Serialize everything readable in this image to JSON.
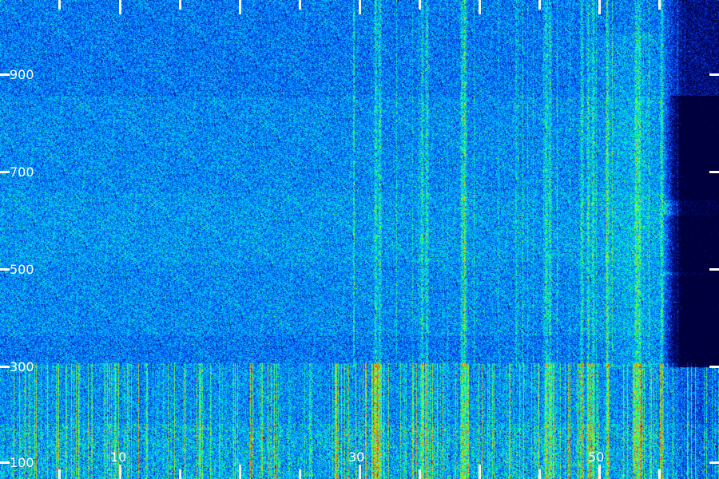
{
  "spectrogram": {
    "colormap": [
      "#00003c",
      "#0014a0",
      "#0050ff",
      "#00b4ff",
      "#00ffb4",
      "#b4ff00",
      "#ff8c00",
      "#ff1e00"
    ],
    "background": "#000000"
  },
  "axes": {
    "y_labels": [
      "900",
      "700",
      "500",
      "300",
      "100"
    ],
    "x_labels": [
      "10",
      "30",
      "50"
    ]
  }
}
